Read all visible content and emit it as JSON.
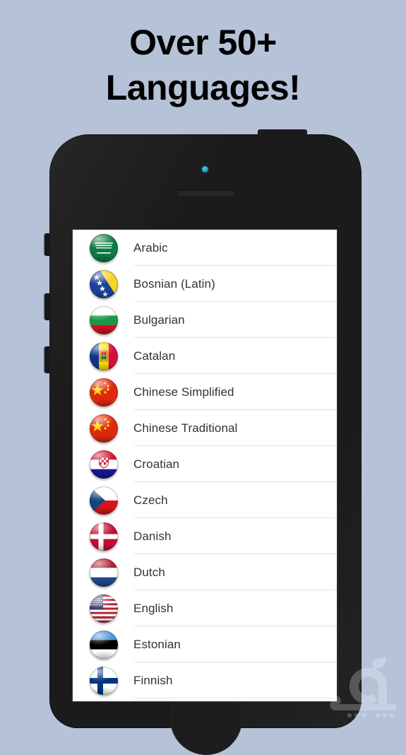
{
  "headline": {
    "line1": "Over 50+",
    "line2": "Languages!"
  },
  "colors": {
    "background": "#b5c2d8",
    "phone_body": "#1b1b1b",
    "screen": "#ffffff",
    "row_text": "#333333",
    "separator": "#e2e2e2",
    "camera_led": "#2fb3d8"
  },
  "device": {
    "type": "smartphone-mockup",
    "buttons": {
      "power": "power-button",
      "mute": "mute-switch",
      "volume_up": "volume-up-button",
      "volume_down": "volume-down-button",
      "home": "home-button"
    },
    "camera": "front-camera",
    "earpiece": "earpiece-speaker"
  },
  "screen": {
    "list_title": "Languages",
    "rows": [
      {
        "label": "Arabic",
        "flag": "saudi-arabia-flag-icon"
      },
      {
        "label": "Bosnian (Latin)",
        "flag": "bosnia-flag-icon"
      },
      {
        "label": "Bulgarian",
        "flag": "bulgaria-flag-icon"
      },
      {
        "label": "Catalan",
        "flag": "andorra-flag-icon"
      },
      {
        "label": "Chinese Simplified",
        "flag": "china-flag-icon"
      },
      {
        "label": "Chinese Traditional",
        "flag": "china-flag-icon"
      },
      {
        "label": "Croatian",
        "flag": "croatia-flag-icon"
      },
      {
        "label": "Czech",
        "flag": "czech-flag-icon"
      },
      {
        "label": "Danish",
        "flag": "denmark-flag-icon"
      },
      {
        "label": "Dutch",
        "flag": "netherlands-flag-icon"
      },
      {
        "label": "English",
        "flag": "usa-flag-icon"
      },
      {
        "label": "Estonian",
        "flag": "estonia-flag-icon"
      },
      {
        "label": "Finnish",
        "flag": "finland-flag-icon"
      }
    ]
  },
  "watermark": {
    "name": "sibapp-watermark",
    "text": "سیب اپ"
  }
}
